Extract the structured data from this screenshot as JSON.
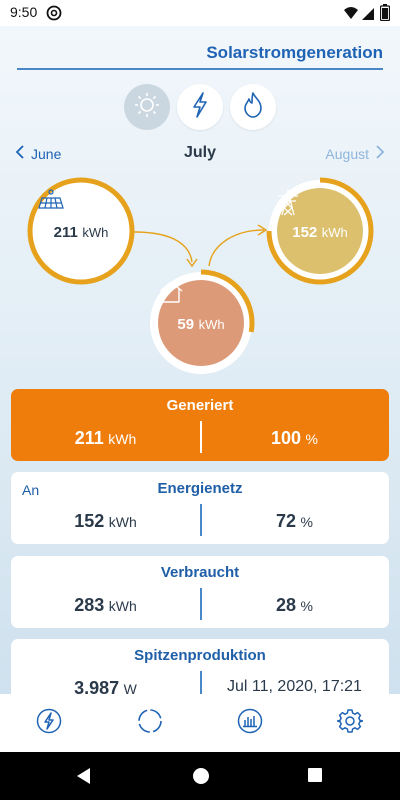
{
  "status": {
    "time": "9:50"
  },
  "header": {
    "title": "Solarstromgeneration"
  },
  "segments": [
    {
      "icon": "sun-icon",
      "active": true
    },
    {
      "icon": "lightning-icon",
      "active": false
    },
    {
      "icon": "flame-icon",
      "active": false
    }
  ],
  "months": {
    "prev": "June",
    "current": "July",
    "next": "August"
  },
  "nodes": {
    "solar": {
      "value": "211",
      "unit": "kWh",
      "icon": "solar-panel-icon"
    },
    "grid": {
      "value": "152",
      "unit": "kWh",
      "icon": "power-pylon-icon"
    },
    "home": {
      "value": "59",
      "unit": "kWh",
      "icon": "house-icon"
    }
  },
  "cards": {
    "generated": {
      "title": "Generiert",
      "value": "211",
      "unit": "kWh",
      "percent": "100",
      "percent_unit": "%"
    },
    "grid": {
      "label": "An",
      "title": "Energienetz",
      "value": "152",
      "unit": "kWh",
      "percent": "72",
      "percent_unit": "%"
    },
    "consumed": {
      "title": "Verbraucht",
      "value": "283",
      "unit": "kWh",
      "percent": "28",
      "percent_unit": "%"
    },
    "peak": {
      "title": "Spitzenproduktion",
      "value": "3.987",
      "unit": "W",
      "date": "Jul 11, 2020, 17:21"
    }
  },
  "colors": {
    "accent": "#1f63b5",
    "orange": "#ef7d0c",
    "ring": "#e6a21d",
    "grid_fill": "#dcc06e",
    "home_fill": "#dd9a78"
  },
  "tabs": [
    "lightning-icon",
    "circle-icon",
    "chart-icon",
    "gear-icon"
  ]
}
